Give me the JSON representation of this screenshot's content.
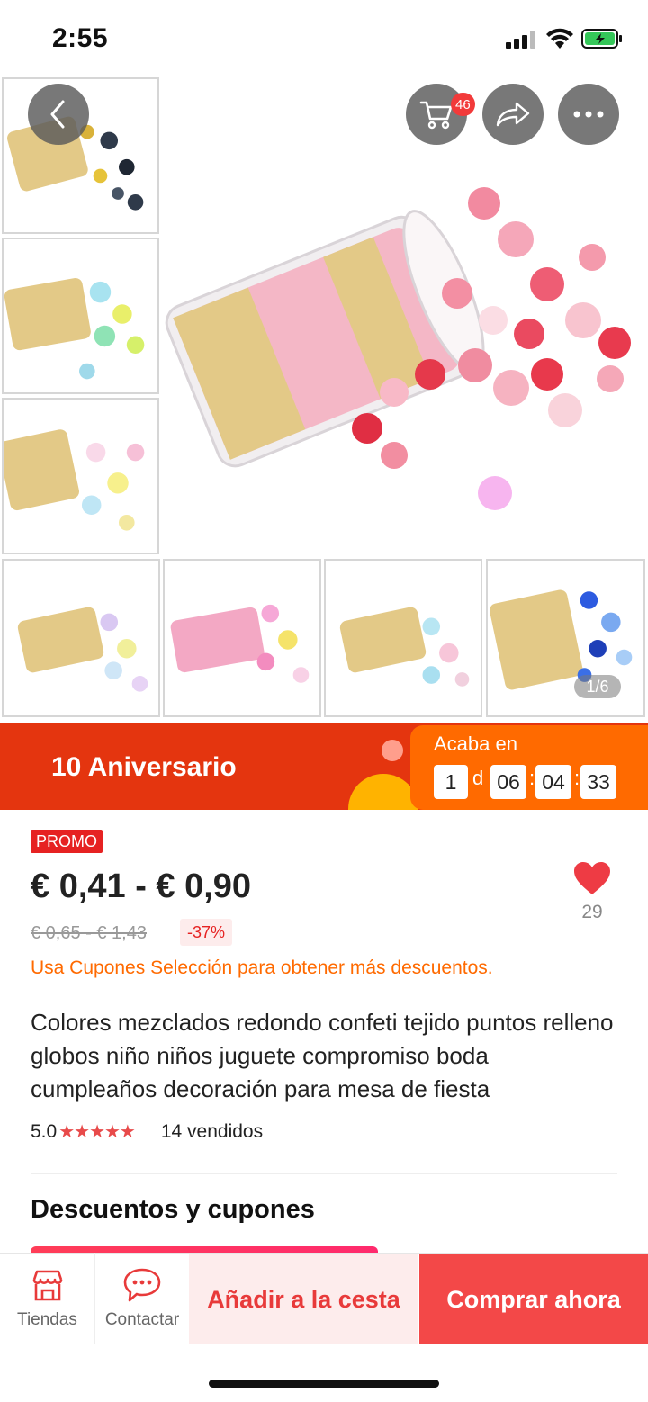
{
  "status_bar": {
    "time": "2:55"
  },
  "gallery": {
    "cart_badge": "46",
    "image_counter": "1/6"
  },
  "banner": {
    "title": "10 Aniversario",
    "countdown_label": "Acaba en",
    "days": "1",
    "days_unit": "d",
    "hours": "06",
    "minutes": "04",
    "seconds": "33",
    "sep": ":"
  },
  "product": {
    "promo_tag": "PROMO",
    "price": "€ 0,41 - € 0,90",
    "old_price": "€ 0,65 - € 1,43",
    "discount": "-37%",
    "wishlist_count": "29",
    "coupon_note": "Usa Cupones Selección para obtener más descuentos.",
    "title": "Colores mezclados redondo confeti tejido puntos relleno globos niño niños juguete compromiso boda cumpleaños decoración para mesa de fiesta",
    "rating": "5.0",
    "stars": "★★★★★",
    "sold": "14 vendidos"
  },
  "section": {
    "title": "Descuentos y cupones"
  },
  "bottom_bar": {
    "stores_label": "Tiendas",
    "contact_label": "Contactar",
    "add_to_cart": "Añadir a la cesta",
    "buy_now": "Comprar ahora"
  },
  "colors": {
    "accent": "#f34848",
    "banner_red": "#e4350f",
    "countdown_orange": "#ff6a00",
    "coupon_orange": "#ff6a00"
  }
}
